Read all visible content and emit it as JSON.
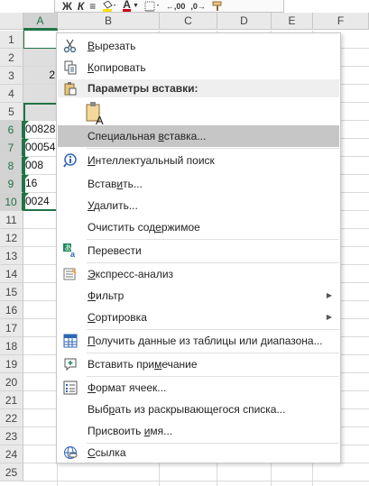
{
  "toolbar": {
    "bold": "Ж",
    "italic": "К",
    "align": "≡",
    "increase_decimal": ",00",
    "decrease_decimal": ",0",
    "font_color_letter": "A"
  },
  "columns": [
    "A",
    "B",
    "C",
    "D",
    "E",
    "F"
  ],
  "rows": [
    "1",
    "2",
    "3",
    "4",
    "5",
    "6",
    "7",
    "8",
    "9",
    "10",
    "11",
    "12",
    "13",
    "14",
    "15",
    "16",
    "17",
    "18",
    "19",
    "20",
    "21",
    "22",
    "23",
    "24",
    "25"
  ],
  "cells": {
    "a3": "2",
    "a6": "00828",
    "a7": "00054",
    "a8": "008",
    "a9": "16",
    "a10": "0024"
  },
  "menu": {
    "cut": {
      "pre": "",
      "u": "В",
      "post": "ырезать"
    },
    "copy": {
      "pre": "",
      "u": "К",
      "post": "опировать"
    },
    "paste_options_header": "Параметры вставки:",
    "paste_special": {
      "pre": "Специальная ",
      "u": "в",
      "post": "ставка..."
    },
    "smart_lookup": {
      "pre": "",
      "u": "И",
      "post": "нтеллектуальный поиск"
    },
    "insert": {
      "pre": "Встав",
      "u": "и",
      "post": "ть..."
    },
    "delete": {
      "pre": "",
      "u": "У",
      "post": "далить..."
    },
    "clear_contents": {
      "pre": "Очистить сод",
      "u": "е",
      "post": "ржимое"
    },
    "translate": "Перевести",
    "quick_analysis": {
      "pre": "",
      "u": "Э",
      "post": "кспресс-анализ"
    },
    "filter": {
      "pre": "",
      "u": "Ф",
      "post": "ильтр"
    },
    "sort": {
      "pre": "",
      "u": "С",
      "post": "ортировка"
    },
    "get_data": {
      "pre": "",
      "u": "П",
      "post": "олучить данные из таблицы или диапазона..."
    },
    "insert_comment": {
      "pre": "Вставить при",
      "u": "м",
      "post": "ечание"
    },
    "format_cells": {
      "pre": "",
      "u": "Ф",
      "post": "ормат ячеек..."
    },
    "pick_from_list": {
      "pre": "Выб",
      "u": "р",
      "post": "ать из раскрывающегося списка..."
    },
    "define_name": {
      "pre": "Присвоить ",
      "u": "и",
      "post": "мя..."
    },
    "link": {
      "pre": "",
      "u": "С",
      "post": "сылка"
    }
  },
  "colors": {
    "selection_green": "#217346",
    "menu_highlight": "#c6c6c6",
    "font_color_red": "#d0021b",
    "fill_yellow": "#ffe100"
  }
}
